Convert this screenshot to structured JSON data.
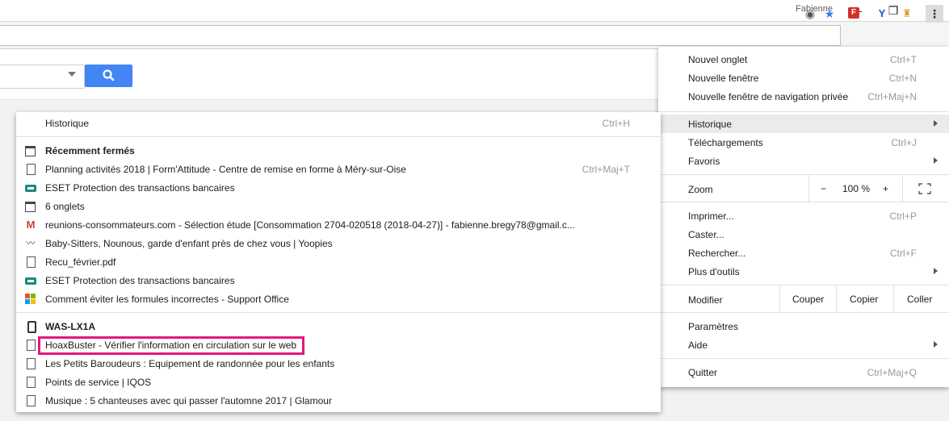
{
  "window": {
    "profile_name": "Fabienne",
    "min_glyph": "—",
    "max_glyph": "❐",
    "close_glyph": "✕"
  },
  "toolbar": {
    "eye_glyph": "◉",
    "star_glyph": "★",
    "ext1_glyph": "F",
    "ext2_glyph": "Y",
    "ext3_glyph": "♜",
    "menu_glyph": "⋮",
    "icons": [
      "eye-icon",
      "bookmark-star-icon",
      "flipboard-extension-icon",
      "ext-y-icon",
      "ext-figure-icon",
      "chrome-menu-icon"
    ]
  },
  "page": {
    "search_button_icon": "search-icon",
    "accent_color": "#4285f4"
  },
  "main_menu": {
    "nouvel_onglet": {
      "label": "Nouvel onglet",
      "shortcut": "Ctrl+T"
    },
    "nouvelle_fenetre": {
      "label": "Nouvelle fenêtre",
      "shortcut": "Ctrl+N"
    },
    "navigation_privee": {
      "label": "Nouvelle fenêtre de navigation privée",
      "shortcut": "Ctrl+Maj+N"
    },
    "historique": {
      "label": "Historique"
    },
    "telechargements": {
      "label": "Téléchargements",
      "shortcut": "Ctrl+J"
    },
    "favoris": {
      "label": "Favoris"
    },
    "zoom": {
      "label": "Zoom",
      "minus": "−",
      "value": "100 %",
      "plus": "+"
    },
    "imprimer": {
      "label": "Imprimer...",
      "shortcut": "Ctrl+P"
    },
    "caster": {
      "label": "Caster..."
    },
    "rechercher": {
      "label": "Rechercher...",
      "shortcut": "Ctrl+F"
    },
    "plus_outils": {
      "label": "Plus d'outils"
    },
    "modifier": {
      "label": "Modifier",
      "couper": "Couper",
      "copier": "Copier",
      "coller": "Coller"
    },
    "parametres": {
      "label": "Paramètres"
    },
    "aide": {
      "label": "Aide"
    },
    "quitter": {
      "label": "Quitter",
      "shortcut": "Ctrl+Maj+Q"
    }
  },
  "history": {
    "header": {
      "label": "Historique",
      "shortcut": "Ctrl+H"
    },
    "recent_title": "Récemment fermés",
    "recent": [
      {
        "label": "Planning activités 2018 | Form'Attitude - Centre de remise en forme à Méry-sur-Oise",
        "shortcut": "Ctrl+Maj+T",
        "icon": "page-icon"
      },
      {
        "label": "ESET Protection des transactions bancaires",
        "icon": "eset-icon"
      },
      {
        "label": "6 onglets",
        "icon": "window-icon"
      },
      {
        "label": "reunions-consommateurs.com - Sélection étude [Consommation 2704-020518 (2018-04-27)] - fabienne.bregy78@gmail.c...",
        "icon": "gmail-icon"
      },
      {
        "label": "Baby-Sitters, Nounous, garde d'enfant près de chez vous | Yoopies",
        "icon": "yoopies-icon"
      },
      {
        "label": "Recu_février.pdf",
        "icon": "page-icon"
      },
      {
        "label": "ESET Protection des transactions bancaires",
        "icon": "eset-icon"
      },
      {
        "label": "Comment éviter les formules incorrectes - Support Office",
        "icon": "microsoft-icon"
      }
    ],
    "device_title": "WAS-LX1A",
    "device": [
      {
        "label": "HoaxBuster - Vérifier l'information en circulation sur le web",
        "icon": "page-icon",
        "highlight_color": "#e5177e"
      },
      {
        "label": "Les Petits Baroudeurs : Equipement de randonnée pour les enfants",
        "icon": "page-icon"
      },
      {
        "label": "Points de service | IQOS",
        "icon": "page-icon"
      },
      {
        "label": "Musique : 5 chanteuses avec qui passer l'automne 2017 | Glamour",
        "icon": "page-icon"
      }
    ]
  }
}
